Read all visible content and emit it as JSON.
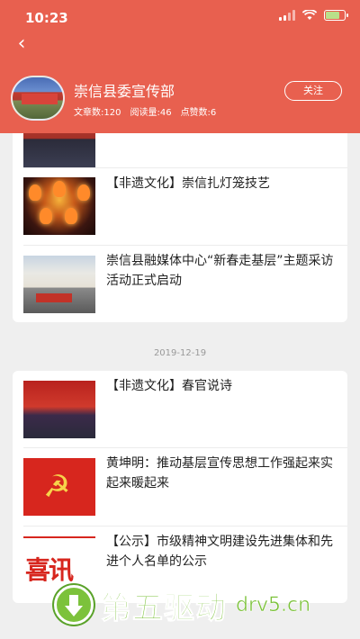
{
  "status_bar": {
    "time": "10:23"
  },
  "header": {
    "account_name": "崇信县委宣传部",
    "stats": {
      "articles": "文章数:120",
      "views": "阅读量:46",
      "likes": "点赞数:6"
    },
    "follow_label": "关注"
  },
  "groups": [
    {
      "date": "",
      "articles": [
        {
          "title": "",
          "thumb": "partial-photo"
        },
        {
          "title": "【非遗文化】崇信扎灯笼技艺",
          "thumb": "lantern-photo"
        },
        {
          "title": "崇信县融媒体中心“新春走基层”主题采访活动正式启动",
          "thumb": "building-photo"
        }
      ]
    },
    {
      "date": "2019-12-19",
      "articles": [
        {
          "title": "【非遗文化】春官说诗",
          "thumb": "stage-photo"
        },
        {
          "title": "黄坤明：推动基层宣传思想工作强起来实起来暖起来",
          "thumb": "party-emblem"
        },
        {
          "title": "【公示】市级精神文明建设先进集体和先进个人名单的公示",
          "thumb": "xixun-poster"
        }
      ]
    }
  ],
  "thumb_text": {
    "xixun": "喜讯"
  },
  "watermark": {
    "brand": "第五驱动",
    "domain": "drv5.cn"
  },
  "colors": {
    "accent": "#e8604f",
    "background": "#efefef"
  }
}
